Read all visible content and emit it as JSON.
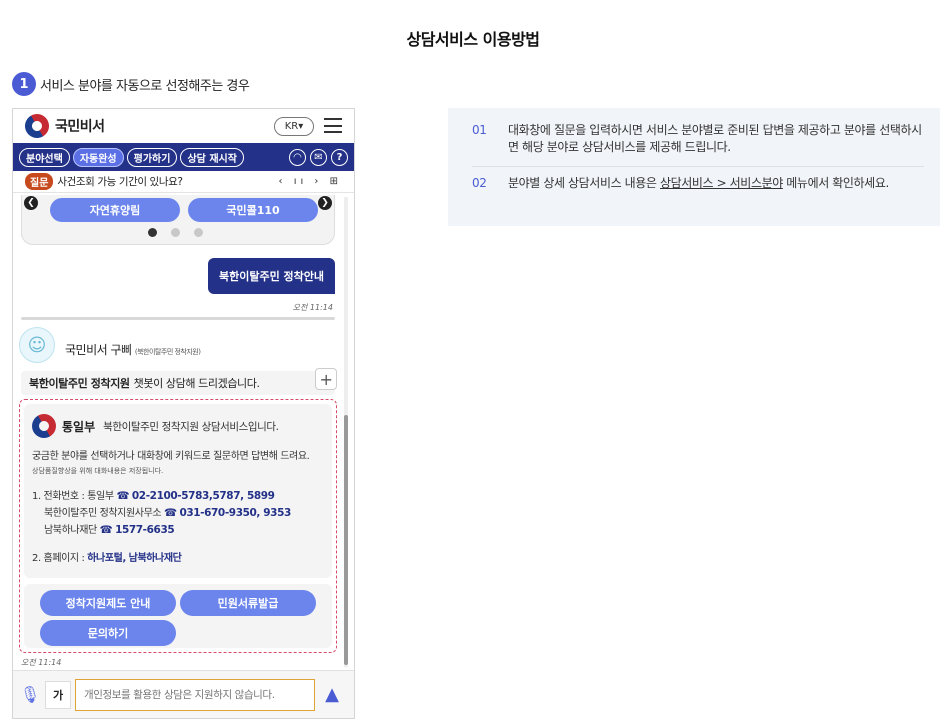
{
  "page": {
    "title": "상담서비스 이용방법"
  },
  "step1": {
    "num": "1",
    "text": "서비스 분야를 자동으로 선정해주는 경우"
  },
  "phone": {
    "logo_text": "국민비서",
    "lang_button": "KR",
    "nav": [
      {
        "label": "분야선택",
        "active": false
      },
      {
        "label": "자동완성",
        "active": true
      },
      {
        "label": "평가하기",
        "active": false
      },
      {
        "label": "상담 재시작",
        "active": false
      }
    ],
    "nav_icons": [
      "headset-icon",
      "mail-icon",
      "help-icon"
    ],
    "ticker": {
      "badge": "질문",
      "text": "사건조회 가능 기간이 있나요?",
      "controls": "‹ ıı › ⊞"
    },
    "carousel": {
      "buttons": [
        "자연휴양림",
        "국민콜110"
      ],
      "active_dot": 0,
      "dot_count": 3
    },
    "user_message": {
      "text": "북한이탈주민 정착안내",
      "time": "오전 11:14"
    },
    "bot": {
      "name": "국민비서 구삐",
      "name_sub": "(북한이탈주민 정착지원)",
      "intro_bold": "북한이탈주민 정착지원",
      "intro_text": "챗봇이 상담해 드리겠습니다."
    },
    "card": {
      "ministry": "통일부",
      "ministry_sub": "북한이탈주민 정착지원 상담서비스입니다.",
      "para": "궁금한 분야를 선택하거나 대화창에 키워드로 질문하면 답변해 드려요.",
      "small": "상담품질향상을 위해 대화내용은 저장됩니다.",
      "phone_label": "1. 전화번호 : 통일부",
      "phone1": "02-2100-5783,5787, 5899",
      "office_label": "북한이탈주민 정착지원사무소",
      "phone2": "031-670-9350, 9353",
      "foundation_label": "남북하나재단",
      "phone3": "1577-6635",
      "home_label": "2. 홈페이지 :",
      "home_link1": "하나포털",
      "home_sep": ",",
      "home_link2": "남북하나재단"
    },
    "actions": [
      "정착지원제도 안내",
      "민원서류발급",
      "문의하기"
    ],
    "bot_time": "오전 11:14",
    "input": {
      "ga": "가",
      "placeholder": "개인정보를 활용한 상담은 지원하지 않습니다."
    }
  },
  "info": [
    {
      "num": "01",
      "text": "대화창에 질문을 입력하시면 서비스 분야별로 준비된 답변을 제공하고 분야를 선택하시면 해당 분야로 상담서비스를 제공해 드립니다."
    },
    {
      "num": "02",
      "text_before": "분야별 상세 상담서비스 내용은 ",
      "link": "상담서비스 > 서비스분야",
      "text_after": " 메뉴에서 확인하세요."
    }
  ],
  "colors": {
    "accent": "#4a5bd4",
    "nav_bg": "#233188",
    "button": "#6b85ec",
    "badge": "#c74a1f",
    "dashed": "#d64a6a"
  }
}
